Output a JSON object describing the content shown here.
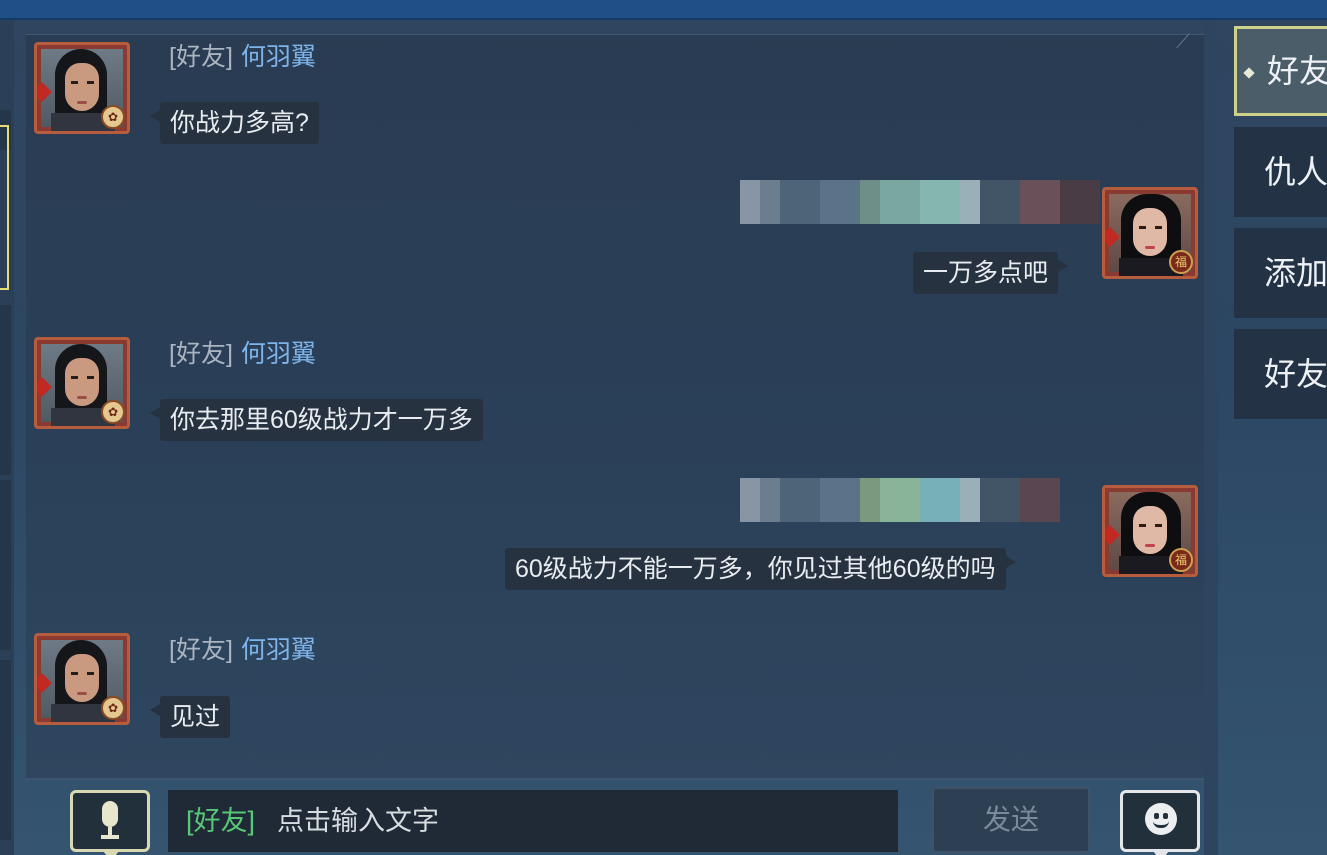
{
  "messages": [
    {
      "side": "left",
      "channel_tag": "[好友]",
      "sender_name": "何羽翼",
      "text": "你战力多高?"
    },
    {
      "side": "right",
      "text": "一万多点吧"
    },
    {
      "side": "left",
      "channel_tag": "[好友]",
      "sender_name": "何羽翼",
      "text": "你去那里60级战力才一万多"
    },
    {
      "side": "right",
      "text": "60级战力不能一万多，你见过其他60级的吗"
    },
    {
      "side": "left",
      "channel_tag": "[好友]",
      "sender_name": "何羽翼",
      "text": "见过"
    }
  ],
  "avatar_badges": {
    "friend": "✿",
    "self": "福"
  },
  "sidebar": {
    "tabs": [
      {
        "label": "好友",
        "active": true
      },
      {
        "label": "仇人",
        "active": false
      },
      {
        "label": "添加",
        "active": false
      },
      {
        "label": "好友",
        "active": false
      }
    ]
  },
  "input": {
    "channel": "[好友]",
    "placeholder": "点击输入文字",
    "send_label": "发送"
  },
  "icons": {
    "voice": "microphone-icon",
    "emoji": "smiley-face-icon"
  },
  "colors": {
    "friend_name": "#7fb4ea",
    "channel_tag_input": "#58c878",
    "active_tab_border": "#cfd28a",
    "top_bar": "#1f4f86"
  }
}
